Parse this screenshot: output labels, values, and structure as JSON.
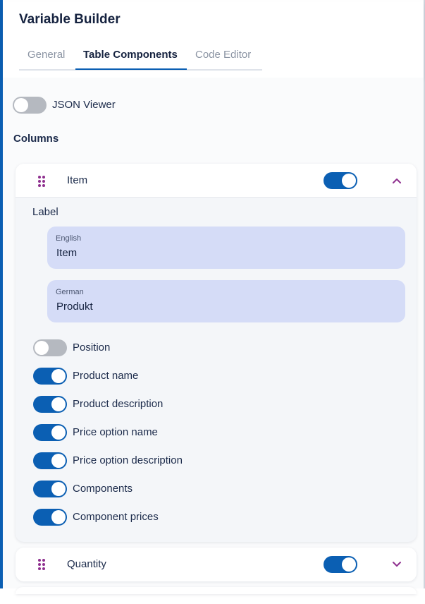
{
  "app": {
    "title": "Variable Builder"
  },
  "tabs": [
    {
      "label": "General",
      "active": false
    },
    {
      "label": "Table Components",
      "active": true
    },
    {
      "label": "Code Editor",
      "active": false
    }
  ],
  "json_viewer": {
    "label": "JSON Viewer",
    "enabled": false
  },
  "columns_heading": "Columns",
  "columns": [
    {
      "name": "Item",
      "enabled": true,
      "expanded": true,
      "label_heading": "Label",
      "translations": [
        {
          "language": "English",
          "value": "Item"
        },
        {
          "language": "German",
          "value": "Produkt"
        }
      ],
      "options": [
        {
          "label": "Position",
          "enabled": false
        },
        {
          "label": "Product name",
          "enabled": true
        },
        {
          "label": "Product description",
          "enabled": true
        },
        {
          "label": "Price option name",
          "enabled": true
        },
        {
          "label": "Price option description",
          "enabled": true
        },
        {
          "label": "Components",
          "enabled": true
        },
        {
          "label": "Component prices",
          "enabled": true
        }
      ]
    },
    {
      "name": "Quantity",
      "enabled": true,
      "expanded": false
    }
  ],
  "colors": {
    "accent": "#0b5fb3",
    "grip": "#8e2f8e",
    "field_bg": "#d5dcf7"
  },
  "icons": {
    "drag": "drag-handle-icon",
    "collapse": "chevron-up-icon",
    "expand": "chevron-down-icon"
  }
}
